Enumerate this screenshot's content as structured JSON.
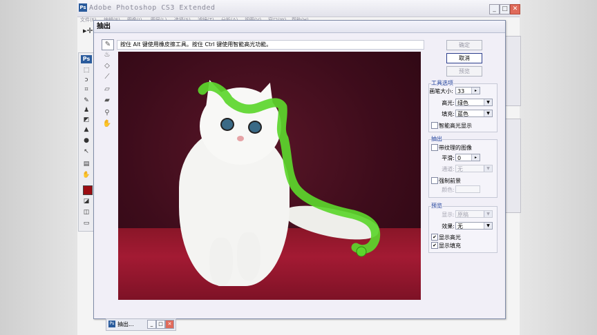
{
  "app": {
    "title": "Adobe Photoshop CS3 Extended",
    "logo": "Ps",
    "window_controls": [
      "_",
      "□",
      "✕"
    ],
    "menus": [
      "文件(F)",
      "编辑(E)",
      "图像(I)",
      "图层(L)",
      "选择(S)",
      "滤镜(T)",
      "分析(A)",
      "视图(V)",
      "窗口(W)",
      "帮助(H)"
    ]
  },
  "dialog": {
    "title": "抽出",
    "hint": "按住 Alt 键使用橡皮擦工具。按住 Ctrl 键使用智能高光功能。",
    "buttons": {
      "ok": "确定",
      "cancel": "取消",
      "preview": "预览"
    },
    "tool_options": {
      "title": "工具选项",
      "brush_size_label": "画笔大小:",
      "brush_size_value": "33",
      "highlight_label": "高光:",
      "highlight_value": "绿色",
      "fill_label": "填充:",
      "fill_value": "蓝色",
      "smart_highlight_label": "智能高光显示",
      "smart_highlight_checked": false
    },
    "extraction": {
      "title": "抽出",
      "textured_label": "带纹理的图像",
      "smooth_label": "平滑:",
      "smooth_value": "0",
      "channel_label": "通道:",
      "channel_value": "无",
      "force_fg_label": "强制前景",
      "color_label": "颜色:"
    },
    "preview": {
      "title": "预览",
      "show_label": "显示:",
      "show_value": "原稿",
      "effect_label": "效果:",
      "effect_value": "无",
      "show_highlight_label": "显示高光",
      "show_highlight_checked": true,
      "show_fill_label": "显示填充",
      "show_fill_checked": true
    }
  },
  "colors": {
    "highlight": "#5cd62c",
    "foreground_swatch": "#9b0c12",
    "accent": "#2a5b9c"
  },
  "taskbar": {
    "label": "抽出..."
  }
}
